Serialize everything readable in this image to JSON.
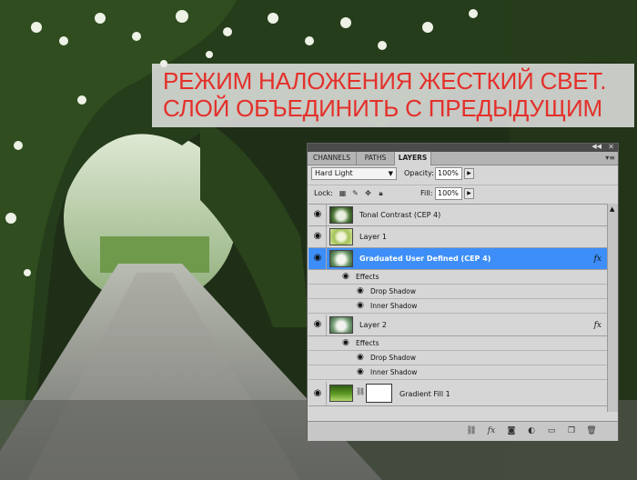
{
  "caption": {
    "line1": "РЕЖИМ НАЛОЖЕНИЯ ЖЕСТКИЙ СВЕТ.",
    "line2": "СЛОЙ ОБЪЕДИНИТЬ С ПРЕДЫДУЩИМ",
    "color": "#e4302b"
  },
  "panel": {
    "tabs": [
      {
        "label": "CHANNELS",
        "active": false
      },
      {
        "label": "PATHS",
        "active": false
      },
      {
        "label": "LAYERS",
        "active": true
      }
    ],
    "blend_mode": "Hard Light",
    "opacity_label": "Opacity:",
    "opacity_value": "100%",
    "lock_label": "Lock:",
    "fill_label": "Fill:",
    "fill_value": "100%",
    "selected_color": "#3d8ef8",
    "layers": [
      {
        "name": "Tonal Contrast (CEP 4)",
        "visible": true,
        "selected": false,
        "has_fx": false
      },
      {
        "name": "Layer 1",
        "visible": true,
        "selected": false,
        "has_fx": false
      },
      {
        "name": "Graduated User Defined (CEP 4)",
        "visible": true,
        "selected": true,
        "has_fx": true,
        "effects_label": "Effects",
        "effects": [
          "Drop Shadow",
          "Inner Shadow"
        ]
      },
      {
        "name": "Layer 2",
        "visible": true,
        "selected": false,
        "has_fx": true,
        "effects_label": "Effects",
        "effects": [
          "Drop Shadow",
          "Inner Shadow"
        ]
      },
      {
        "name": "Gradient Fill 1",
        "visible": true,
        "selected": false,
        "has_fx": false
      }
    ],
    "fx_label": "fx",
    "bottom_icons": [
      "link-layers-icon",
      "fx-icon",
      "add-mask-icon",
      "adjustment-layer-icon",
      "new-group-icon",
      "new-layer-icon",
      "trash-icon"
    ]
  }
}
